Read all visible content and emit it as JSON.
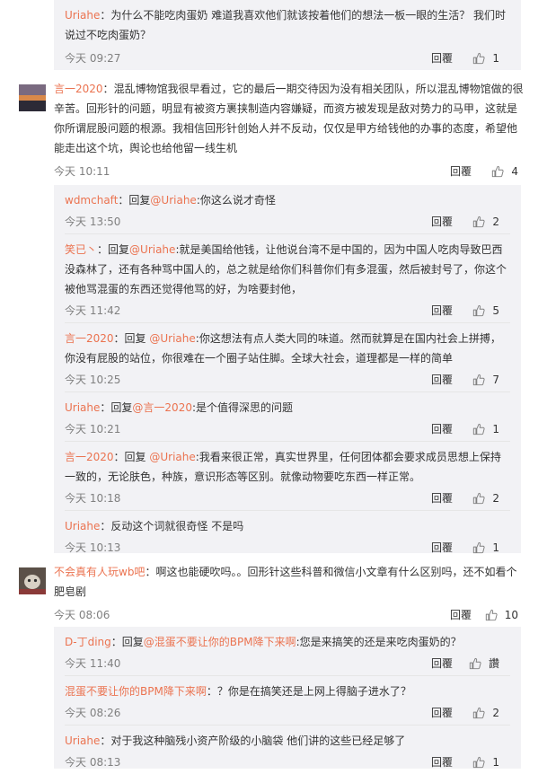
{
  "top_reply": {
    "user": "Uriahe",
    "text": "：为什么不能吃肉蛋奶 难道我喜欢他们就该按着他们的想法一板一眼的生活？ 我们时说过不吃肉蛋奶？",
    "time": "今天 09:27",
    "reply": "回覆",
    "likes": "1"
  },
  "comment1": {
    "user": "言一2020",
    "sep": "：",
    "text": "混乱博物馆我很早看过，它的最后一期交待因为没有相关团队，所以混乱博物馆做的很辛苦。回形针的问题，明显有被资方裹挟制造内容嫌疑，而资方被发现是敌对势力的马甲，这就是你所谓屁股问题的根源。我相信回形针创始人并不反动，仅仅是甲方给钱他的办事的态度，希望他能走出这个坑，舆论也给他留一线生机",
    "time": "今天 10:11",
    "reply": "回覆",
    "likes": "4"
  },
  "replies1": [
    {
      "user": "wdmchaft",
      "pre": "：回复",
      "at": "@Uriahe",
      "text": ":你这么说才奇怪",
      "time": "今天 13:50",
      "reply": "回覆",
      "likes": "2"
    },
    {
      "user": "笑已丶",
      "pre": "：回复",
      "at": "@Uriahe",
      "text": ":就是美国给他钱，让他说台湾不是中国的，因为中国人吃肉导致巴西没森林了，还有各种骂中国人的，总之就是给你们科普你们有多混蛋，然后被封号了，你这个被他骂混蛋的东西还觉得他骂的好，为啥要封他，",
      "time": "今天 11:42",
      "reply": "回覆",
      "likes": "5"
    },
    {
      "user": "言一2020",
      "pre": "：回复 ",
      "at": "@Uriahe",
      "text": ":你这想法有点人类大同的味道。然而就算是在国内社会上拼搏，你没有屁股的站位，你很难在一个圈子站住脚。全球大社会，道理都是一样的简单",
      "time": "今天 10:25",
      "reply": "回覆",
      "likes": "7"
    },
    {
      "user": "Uriahe",
      "pre": "：回复",
      "at": "@言一2020",
      "text": ":是个值得深思的问题",
      "time": "今天 10:21",
      "reply": "回覆",
      "likes": "1"
    },
    {
      "user": "言一2020",
      "pre": "：回复 ",
      "at": "@Uriahe",
      "text": ":我看来很正常，真实世界里，任何团体都会要求成员思想上保持一致的，无论肤色，种族，意识形态等区别。就像动物要吃东西一样正常。",
      "time": "今天 10:18",
      "reply": "回覆",
      "likes": "2"
    },
    {
      "user": "Uriahe",
      "pre": "：",
      "at": "",
      "text": "反动这个词就很奇怪 不是吗",
      "time": "今天 10:13",
      "reply": "回覆",
      "likes": "1"
    }
  ],
  "comment2": {
    "user": "不会真有人玩wb吧",
    "sep": "：",
    "text": "啊这也能硬吹吗。。回形针这些科普和微信小文章有什么区别吗，还不如看个肥皂剧",
    "time": "今天 08:06",
    "reply": "回覆",
    "likes": "10"
  },
  "replies2": [
    {
      "user": "D-丁ding",
      "pre": "：回复",
      "at": "@混蛋不要让你的BPM降下来啊",
      "text": ":您是来搞笑的还是来吃肉蛋奶的？",
      "time": "今天 11:40",
      "reply": "回覆",
      "likes": "讚"
    },
    {
      "user": "混蛋不要让你的BPM降下来啊",
      "pre": "：",
      "at": "",
      "text": "？你是在搞笑还是上网上得脑子进水了？",
      "time": "今天 08:26",
      "reply": "回覆",
      "likes": "2"
    },
    {
      "user": "Uriahe",
      "pre": "：",
      "at": "",
      "text": "对于我这种脑残小资产阶级的小脑袋 他们讲的这些已经足够了",
      "time": "今天 08:13",
      "reply": "回覆",
      "likes": "1"
    }
  ],
  "colors": {
    "link": "#eb7350",
    "bg": "#f2f2f5"
  },
  "icons": {
    "like": "thumbs-up-icon"
  }
}
